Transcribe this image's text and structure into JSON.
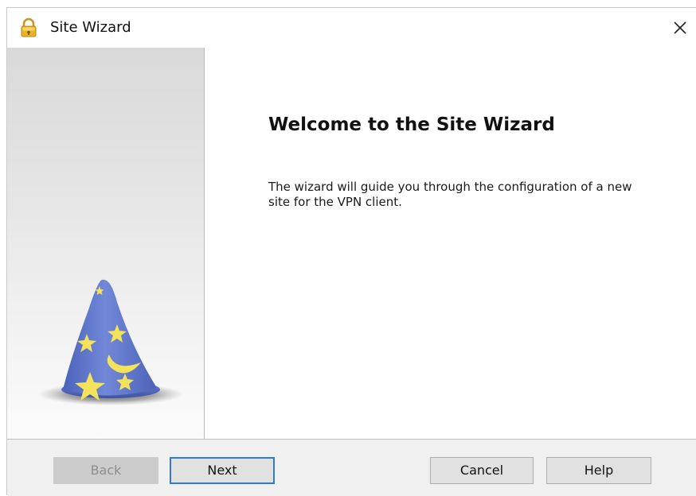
{
  "window": {
    "title": "Site Wizard",
    "title_icon": "lock-icon",
    "close_icon": "close-icon"
  },
  "sidebar": {
    "image": "wizard-hat-icon"
  },
  "main": {
    "heading": "Welcome to the Site Wizard",
    "description": "The wizard will guide you through the configuration of a new site for the VPN client."
  },
  "footer": {
    "back_label": "Back",
    "next_label": "Next",
    "cancel_label": "Cancel",
    "help_label": "Help"
  },
  "colors": {
    "hat_blue": "#5f76c9",
    "star_yellow": "#f4e25a",
    "focus_border": "#2f7ad2",
    "lock_gold": "#e8b32a"
  }
}
